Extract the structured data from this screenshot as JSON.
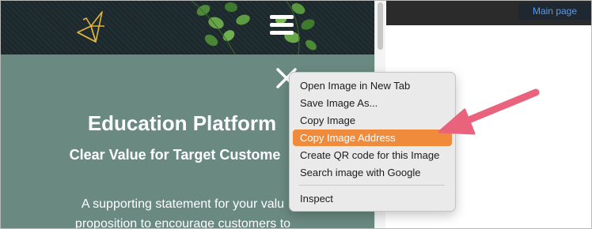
{
  "site": {
    "hero_title": "Education Platform",
    "hero_subtitle": "Clear Value for Target Custome",
    "hero_body_line1": "A supporting statement for your valu",
    "hero_body_line2": "proposition to encourage customers to"
  },
  "browser": {
    "main_page_label": "Main page"
  },
  "context_menu": {
    "items": [
      "Open Image in New Tab",
      "Save Image As...",
      "Copy Image",
      "Copy Image Address",
      "Create QR code for this Image",
      "Search image with Google",
      "Inspect"
    ],
    "highlighted_item": "Copy Image Address"
  },
  "colors": {
    "site_background": "#6a8a81",
    "header_background": "#1d2a2e",
    "menu_highlight": "#ef8b3b",
    "annotation_arrow": "#e9637d",
    "logo_gold": "#e3b43a"
  },
  "icons": {
    "logo": "origami-bird-icon",
    "menu": "hamburger-menu-icon",
    "close": "close-icon"
  }
}
